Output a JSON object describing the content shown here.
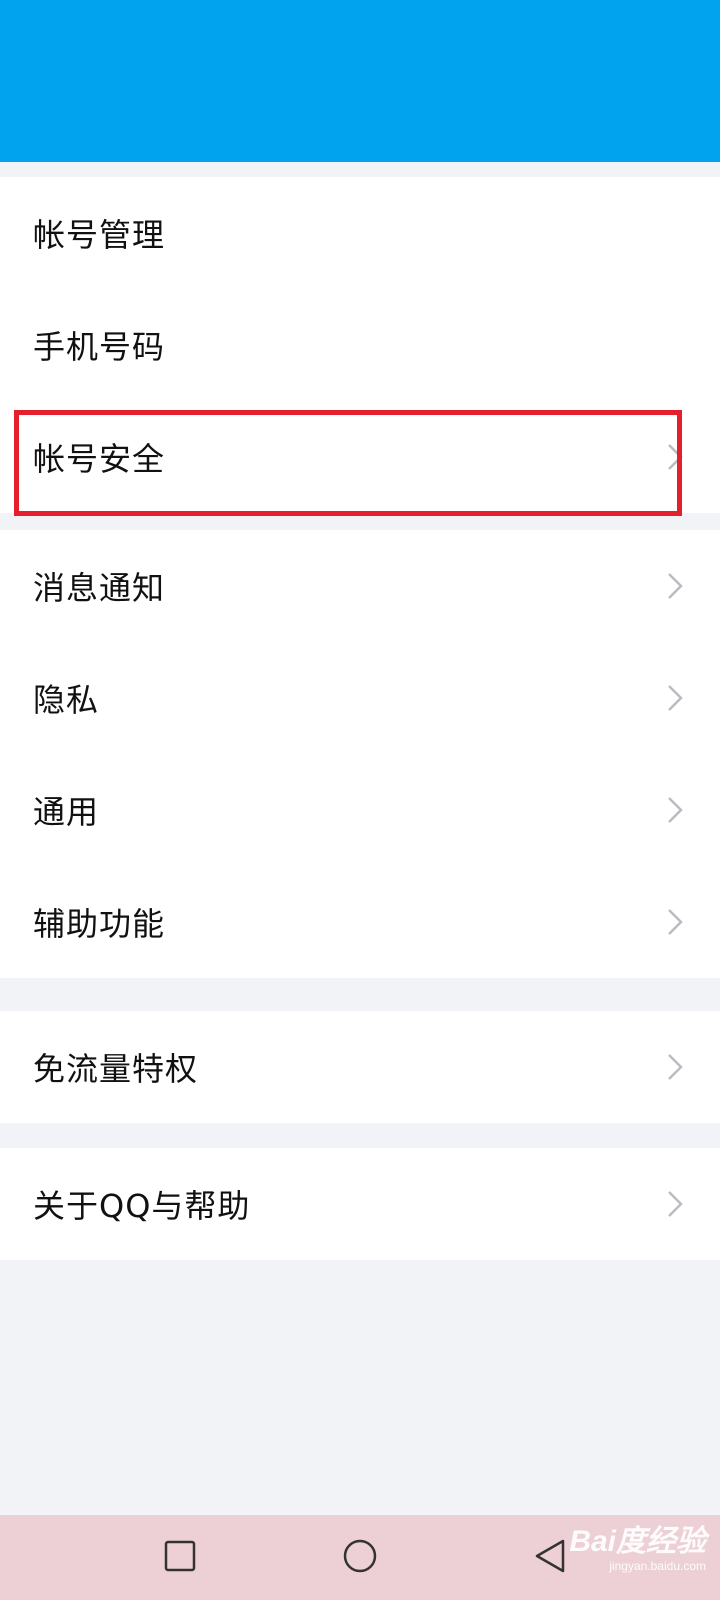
{
  "header": {
    "background": "#02a3ee"
  },
  "groups": [
    {
      "items": [
        {
          "label": "帐号管理",
          "chevron": false
        },
        {
          "label": "手机号码",
          "chevron": false
        },
        {
          "label": "帐号安全",
          "chevron": true
        }
      ]
    },
    {
      "items": [
        {
          "label": "消息通知",
          "chevron": true
        },
        {
          "label": "隐私",
          "chevron": true
        },
        {
          "label": "通用",
          "chevron": true
        },
        {
          "label": "辅助功能",
          "chevron": true
        }
      ]
    },
    {
      "items": [
        {
          "label": "免流量特权",
          "chevron": true
        }
      ]
    },
    {
      "items": [
        {
          "label": "关于QQ与帮助",
          "chevron": true
        }
      ]
    }
  ],
  "highlight": {
    "target": "帐号安全",
    "color": "#e3202b"
  },
  "navbar": {
    "buttons": [
      "recent-apps",
      "home",
      "back"
    ],
    "background": "#ecd0d6"
  },
  "watermark": {
    "main": "Bai度经验",
    "sub": "jingyan.baidu.com"
  }
}
